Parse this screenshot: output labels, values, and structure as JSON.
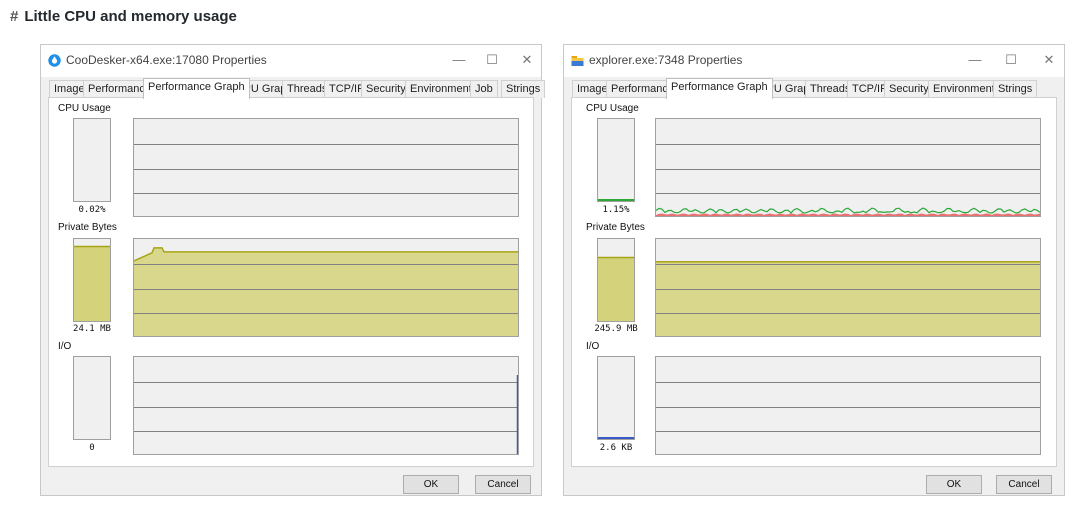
{
  "heading": {
    "hash": "#",
    "text": "Little CPU and memory usage"
  },
  "windows": [
    {
      "title": "CooDesker-x64.exe:17080 Properties",
      "icon": "coodesker-app-icon",
      "controls": {
        "minimize": "—",
        "maximize": "☐",
        "close": "✕"
      },
      "tabs": [
        "Image",
        "Performance",
        "Performance Graph",
        "GPU Graph",
        "Threads",
        "TCP/IP",
        "Security",
        "Environment",
        "Job",
        "Strings"
      ],
      "active_tab": "Performance Graph",
      "sections": {
        "cpu": {
          "label": "CPU Usage",
          "value": "0.02%",
          "level": 0.0002
        },
        "private": {
          "label": "Private Bytes",
          "value": "24.1 MB",
          "level": 0.92
        },
        "io": {
          "label": "I/O",
          "value": "0",
          "level": 0
        }
      },
      "buttons": {
        "ok": "OK",
        "cancel": "Cancel"
      }
    },
    {
      "title": "explorer.exe:7348 Properties",
      "icon": "folder-icon",
      "controls": {
        "minimize": "—",
        "maximize": "☐",
        "close": "✕"
      },
      "tabs": [
        "Image",
        "Performance",
        "Performance Graph",
        "GPU Graph",
        "Threads",
        "TCP/IP",
        "Security",
        "Environment",
        "Strings"
      ],
      "active_tab": "Performance Graph",
      "sections": {
        "cpu": {
          "label": "CPU Usage",
          "value": "1.15%",
          "level": 0.0115
        },
        "private": {
          "label": "Private Bytes",
          "value": "245.9 MB",
          "level": 0.78
        },
        "io": {
          "label": "I/O",
          "value": "2.6  KB",
          "level": 0.01
        }
      },
      "buttons": {
        "ok": "OK",
        "cancel": "Cancel"
      }
    }
  ],
  "colors": {
    "memory_fill": "#d4d27a",
    "memory_line": "#a7a417",
    "cpu_kernel": "#e83c3c",
    "cpu_total": "#2aa838",
    "io_line": "#3a5bc7",
    "grid": "#808080"
  }
}
